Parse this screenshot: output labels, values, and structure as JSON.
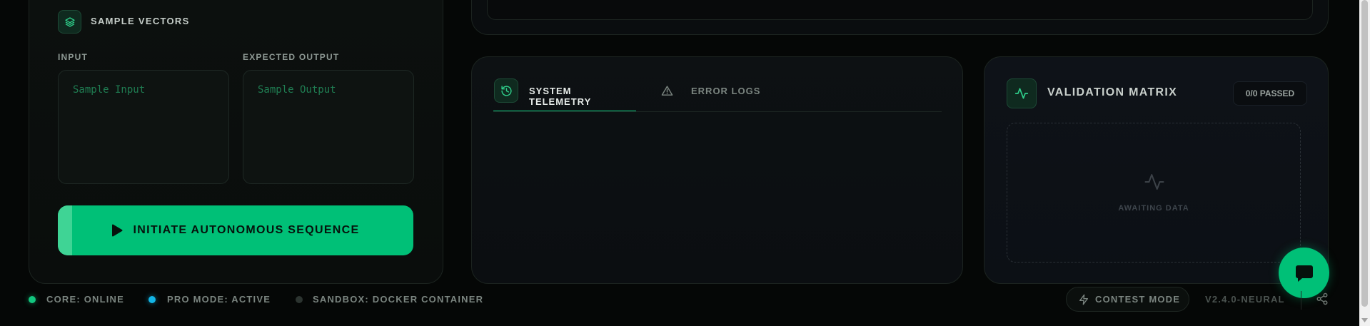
{
  "sample_vectors": {
    "title": "SAMPLE VECTORS",
    "icon": "layers-icon",
    "input_label": "INPUT",
    "input_placeholder": "Sample Input",
    "output_label": "EXPECTED OUTPUT",
    "output_placeholder": "Sample Output"
  },
  "run_button": {
    "label": "INITIATE AUTONOMOUS SEQUENCE",
    "icon": "play-icon"
  },
  "telemetry": {
    "tabs": [
      {
        "label": "SYSTEM TELEMETRY",
        "icon": "history-icon",
        "active": true
      },
      {
        "label": "ERROR LOGS",
        "icon": "warning-icon",
        "active": false
      }
    ]
  },
  "validation": {
    "title": "VALIDATION MATRIX",
    "icon": "activity-icon",
    "badge": "0/0 PASSED",
    "empty_state": "AWAITING DATA"
  },
  "status_bar": {
    "items": [
      {
        "label": "CORE: ONLINE",
        "color": "#12c77f"
      },
      {
        "label": "PRO MODE: ACTIVE",
        "color": "#12b5e6"
      },
      {
        "label": "SANDBOX: DOCKER CONTAINER",
        "color": "#2c3430"
      }
    ],
    "contest_mode": "CONTEST MODE",
    "version": "V2.4.0-NEURAL"
  },
  "colors": {
    "accent": "#00c077",
    "accent_light": "#3fd495",
    "background": "#050706"
  }
}
